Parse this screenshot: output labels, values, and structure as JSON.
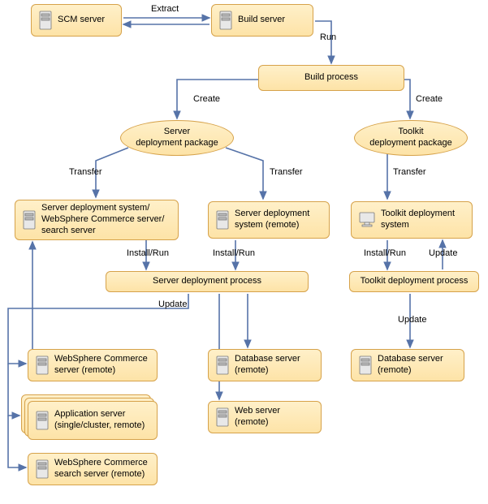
{
  "nodes": {
    "scm": "SCM server",
    "build_server": "Build server",
    "build_process": "Build process",
    "server_pkg_l1": "Server",
    "server_pkg_l2": "deployment package",
    "toolkit_pkg_l1": "Toolkit",
    "toolkit_pkg_l2": "deployment package",
    "sds_local": "Server deployment system/ WebSphere Commerce server/ search server",
    "sds_remote": "Server deployment system (remote)",
    "toolkit_sys": "Toolkit deployment system",
    "server_proc": "Server deployment process",
    "toolkit_proc": "Toolkit deployment process",
    "wc_server": "WebSphere Commerce server (remote)",
    "app_server": "Application server (single/cluster, remote)",
    "wc_search": "WebSphere Commerce search server (remote)",
    "db_server": "Database server (remote)",
    "web_server": "Web server (remote)",
    "db_server2": "Database server (remote)"
  },
  "edges": {
    "extract": "Extract",
    "run": "Run",
    "create": "Create",
    "transfer": "Transfer",
    "install_run": "Install/Run",
    "update": "Update"
  }
}
